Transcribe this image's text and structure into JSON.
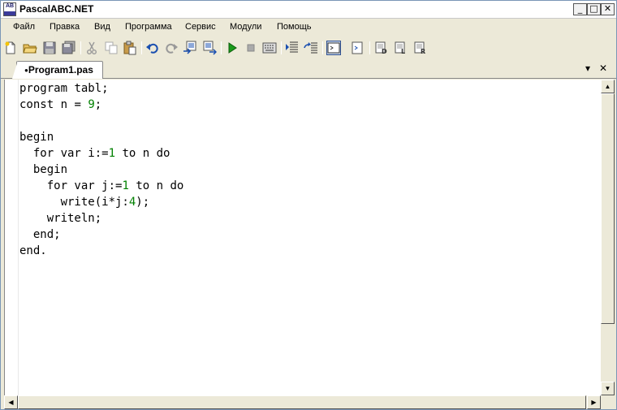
{
  "window": {
    "title": "PascalABC.NET"
  },
  "titlebar": {
    "minimize": "_",
    "maximize": "□",
    "close": "✕"
  },
  "menu": [
    "Файл",
    "Правка",
    "Вид",
    "Программа",
    "Сервис",
    "Модули",
    "Помощь"
  ],
  "toolbar": {
    "icons": [
      "new-file-icon",
      "open-folder-icon",
      "save-icon",
      "save-all-icon",
      "cut-icon",
      "copy-icon",
      "paste-icon",
      "undo-icon",
      "redo-icon",
      "find-icon",
      "replace-icon",
      "run-icon",
      "stop-icon",
      "compile-icon",
      "step-into-icon",
      "step-over-icon",
      "console-icon",
      "output-window-icon",
      "debug-icon",
      "trace-icon",
      "reference-icon"
    ],
    "active": "console-icon"
  },
  "tab": {
    "label": "Program1.pas",
    "modified_marker": "●",
    "menu": "▾",
    "close": "✕"
  },
  "editor": {
    "lines": [
      [
        {
          "t": "kw",
          "v": "program"
        },
        {
          "t": "id",
          "v": " tabl;"
        }
      ],
      [
        {
          "t": "kw",
          "v": "const"
        },
        {
          "t": "id",
          "v": " n = "
        },
        {
          "t": "num",
          "v": "9"
        },
        {
          "t": "id",
          "v": ";"
        }
      ],
      [],
      [
        {
          "t": "kw",
          "v": "begin"
        }
      ],
      [
        {
          "t": "id",
          "v": "  "
        },
        {
          "t": "kw",
          "v": "for var"
        },
        {
          "t": "id",
          "v": " i:="
        },
        {
          "t": "num",
          "v": "1"
        },
        {
          "t": "id",
          "v": " "
        },
        {
          "t": "kw",
          "v": "to"
        },
        {
          "t": "id",
          "v": " n "
        },
        {
          "t": "kw",
          "v": "do"
        }
      ],
      [
        {
          "t": "id",
          "v": "  "
        },
        {
          "t": "kw",
          "v": "begin"
        }
      ],
      [
        {
          "t": "id",
          "v": "    "
        },
        {
          "t": "kw",
          "v": "for var"
        },
        {
          "t": "id",
          "v": " j:="
        },
        {
          "t": "num",
          "v": "1"
        },
        {
          "t": "id",
          "v": " "
        },
        {
          "t": "kw",
          "v": "to"
        },
        {
          "t": "id",
          "v": " n "
        },
        {
          "t": "kw",
          "v": "do"
        }
      ],
      [
        {
          "t": "id",
          "v": "      write(i*j:"
        },
        {
          "t": "num",
          "v": "4"
        },
        {
          "t": "id",
          "v": ");"
        }
      ],
      [
        {
          "t": "id",
          "v": "    writeln;"
        }
      ],
      [
        {
          "t": "id",
          "v": "  "
        },
        {
          "t": "kw",
          "v": "end"
        },
        {
          "t": "id",
          "v": ";"
        }
      ],
      [
        {
          "t": "kw",
          "v": "end"
        },
        {
          "t": "id",
          "v": "."
        }
      ]
    ]
  },
  "scroll": {
    "up": "▲",
    "down": "▼",
    "left": "◀",
    "right": "▶"
  }
}
